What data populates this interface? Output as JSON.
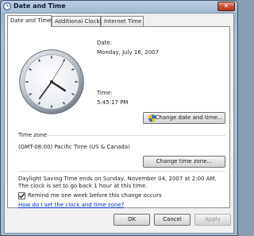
{
  "window": {
    "title": "Date and Time",
    "close_glyph": "✕"
  },
  "tabs": [
    {
      "label": "Date and Time",
      "active": true
    },
    {
      "label": "Additional Clocks",
      "active": false
    },
    {
      "label": "Internet Time",
      "active": false
    }
  ],
  "datetime": {
    "date_label": "Date:",
    "date_value": "Monday, July 16, 2007",
    "time_label": "Time:",
    "time_value": "5:45:17 PM",
    "change_button": "Change date and time..."
  },
  "timezone": {
    "section_label": "Time zone",
    "value": "(GMT-08:00) Pacific Time (US & Canada)",
    "change_button": "Change time zone..."
  },
  "dst": {
    "message": "Daylight Saving Time ends on Sunday, November 04, 2007 at 2:00 AM. The clock is set to go back 1 hour at this time.",
    "remind_label": "Remind me one week before this change occurs",
    "remind_checked": true,
    "help_link": "How do I set the clock and time zone?"
  },
  "footer": {
    "ok": "OK",
    "cancel": "Cancel",
    "apply": "Apply"
  },
  "colors": {
    "link": "#0033cc",
    "titlebar": "#a9bfd6",
    "close": "#c44a31"
  },
  "icons": {
    "title": "clock-icon",
    "shield": "uac-shield-icon",
    "check": "checkmark-icon"
  }
}
